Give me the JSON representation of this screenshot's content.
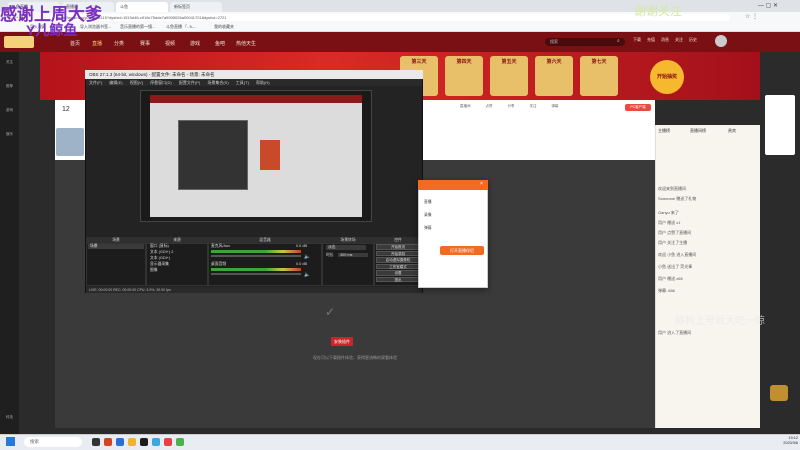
{
  "browser": {
    "tabs": [
      "斗鱼直播",
      "直播间",
      "斗鱼",
      "新标签页"
    ],
    "url": "https://www.douyu.com/5115?dyshid=1515d46-c916c75dde7a9905026a000417018dyshci=2721",
    "bookmarks": [
      "导入收藏",
      "导入浏览器书签...",
      "音乐直播的第一镜...",
      "斗鱼直播 「- 5-...",
      "我的收藏夹"
    ]
  },
  "site": {
    "nav": [
      "首页",
      "直播",
      "分类",
      "赛事",
      "视频",
      "游戏",
      "鱼吧",
      "热他天生"
    ],
    "search_placeholder": "搜索",
    "header_icons": [
      "下载",
      "充值",
      "消息",
      "关注",
      "历史",
      "我的"
    ]
  },
  "rail": [
    "关注",
    "推荐",
    "游戏",
    "娱乐",
    "科技"
  ],
  "banner": {
    "prizes": [
      "第三天",
      "第四天",
      "第五天",
      "第六天",
      "第七天"
    ],
    "cta": "开始抽奖"
  },
  "room": {
    "level": "12",
    "panel_items": [
      "直播间",
      "点赞",
      "分享",
      "关注",
      "弹幕"
    ],
    "pc_badge": "PC客户端"
  },
  "player": {
    "button": "安装插件",
    "hint": "现在可以下载插件体验，获得更流畅的观看体验"
  },
  "chat": {
    "tabs": [
      "主播榜",
      "直播间榜",
      "贵宾"
    ],
    "lines": [
      "欢迎来到直播间",
      "Someone 赠送了礼物",
      "Ganyu 来了",
      "用户 赠送 x1",
      "用户 点赞了直播间",
      "用户 关注了主播",
      "欢迎 小鱼 进入直播间",
      "小鱼 送出了 荧光棒",
      "用户 赠送 x66",
      "弹幕: 666",
      "用户 进入了直播间"
    ]
  },
  "obs": {
    "title": "OBS 27.1.3 (64-bit, windows) - 配置文件: 未命名 - 场景: 未命名",
    "menu": [
      "文件(F)",
      "编辑(E)",
      "视图(V)",
      "停靠窗口(D)",
      "配置文件(P)",
      "场景集合(S)",
      "工具(T)",
      "帮助(H)"
    ],
    "docks": [
      "场景",
      "来源",
      "混音器",
      "场景转场",
      "控件"
    ],
    "scene": "场景",
    "sources": [
      "窗口 (鼠标)",
      "文本 (GDI+) 2",
      "文本 (GDI+)",
      "显示器采集",
      "图像"
    ],
    "mixer": [
      {
        "name": "桌面音频",
        "level": "0.0 dB"
      },
      {
        "name": "麦克风/Aux",
        "level": "0.0 dB"
      }
    ],
    "transition": "淡出",
    "duration_label": "时长",
    "duration": "300 ms",
    "controls": [
      "开始推流",
      "开始录制",
      "启动虚拟摄像机",
      "工作室模式",
      "设置",
      "退出"
    ],
    "status": "LIVE: 00:00:00   REC: 00:00:00   CPU: 3.9%, 30.00 fps"
  },
  "dialog": {
    "options": [
      "直播",
      "录像",
      "弹幕"
    ],
    "button": "打开直播伴侣"
  },
  "overlays": {
    "top_left": "感谢上周大爹",
    "second": "Y儿鲸鱼",
    "top_right": "谢谢关注",
    "chat_overlay": "舔狗上号就大吃一惊"
  },
  "taskbar": {
    "search": "搜索",
    "time": "19:12",
    "date": "2023/3/6"
  },
  "colors": {
    "site_brand": "#7a1014",
    "accent_orange": "#f26b21",
    "overlay_text": "#7b2fbf"
  }
}
